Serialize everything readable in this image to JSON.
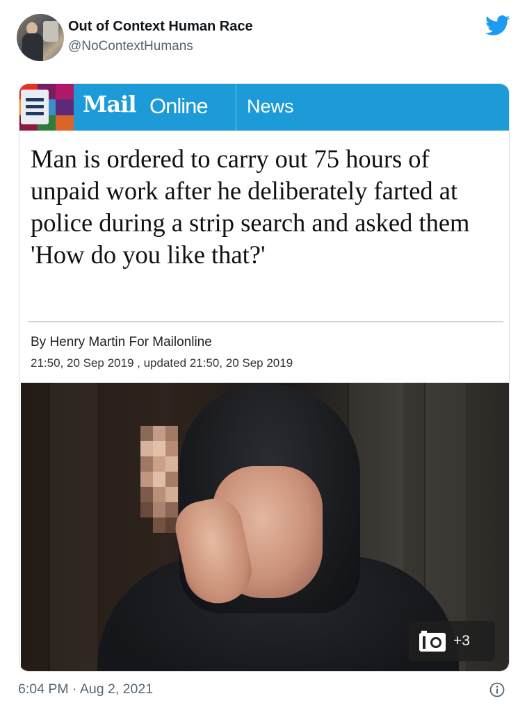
{
  "tweet": {
    "display_name": "Out of Context Human Race",
    "handle": "@NoContextHumans",
    "timestamp": "6:04 PM · Aug 2, 2021"
  },
  "icons": {
    "twitter": "twitter-bird-icon",
    "info": "info-icon",
    "menu": "hamburger-menu-icon",
    "camera": "camera-icon"
  },
  "colors": {
    "twitter_blue": "#1d9bf0",
    "mail_banner": "#1d9bd8",
    "text_primary": "#0f1419",
    "text_secondary": "#536471"
  },
  "article": {
    "brand_mail": "Mail",
    "brand_online": "Online",
    "section": "News",
    "headline": "Man is ordered to carry out 75 hours of unpaid work after he deliberately farted at police during a strip search and asked them 'How do you like that?'",
    "byline": "By Henry Martin For Mailonline",
    "dateline": "21:50, 20 Sep 2019 , updated 21:50, 20 Sep 2019",
    "gallery_count": "+3"
  }
}
